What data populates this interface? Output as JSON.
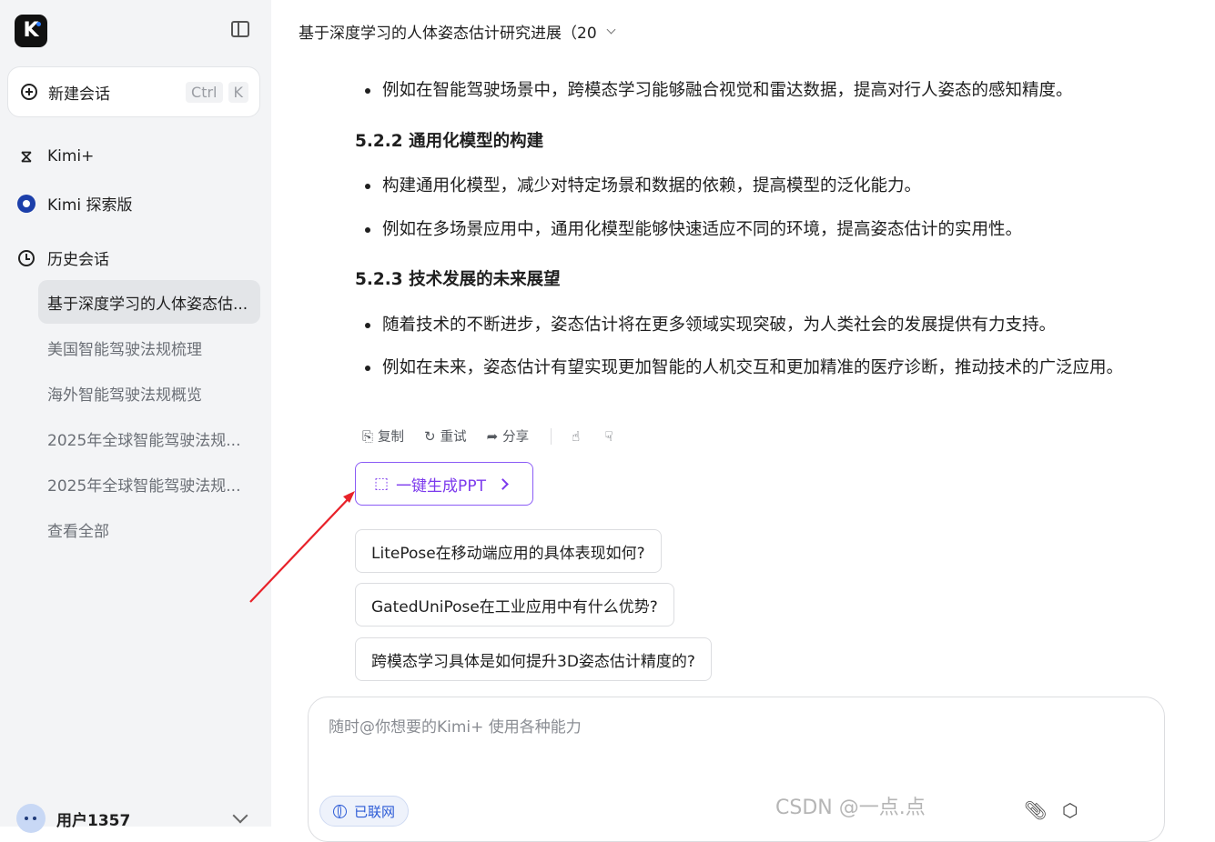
{
  "sidebar": {
    "logo_letter": "K",
    "new_chat": {
      "label": "新建会话",
      "shortcut_keys": [
        "Ctrl",
        "K"
      ]
    },
    "nav": {
      "kimi_plus": "Kimi+",
      "explore": "Kimi 探索版",
      "history": "历史会话"
    },
    "history_items": [
      "基于深度学习的人体姿态估...",
      "美国智能驾驶法规梳理",
      "海外智能驾驶法规概览",
      "2025年全球智能驾驶法规...",
      "2025年全球智能驾驶法规...",
      "查看全部"
    ],
    "user": {
      "name": "用户1357"
    }
  },
  "main": {
    "title": "基于深度学习的人体姿态估计研究进展（20",
    "content": {
      "bullet_1": "例如在智能驾驶场景中，跨模态学习能够融合视觉和雷达数据，提高对行人姿态的感知精度。",
      "heading_2": "5.2.2 通用化模型的构建",
      "bullet_2": "构建通用化模型，减少对特定场景和数据的依赖，提高模型的泛化能力。",
      "bullet_3": "例如在多场景应用中，通用化模型能够快速适应不同的环境，提高姿态估计的实用性。",
      "heading_3": "5.2.3 技术发展的未来展望",
      "bullet_4": "随着技术的不断进步，姿态估计将在更多领域实现突破，为人类社会的发展提供有力支持。",
      "bullet_5": "例如在未来，姿态估计有望实现更加智能的人机交互和更加精准的医疗诊断，推动技术的广泛应用。"
    },
    "actions": {
      "copy": "复制",
      "retry": "重试",
      "share": "分享"
    },
    "ppt_button": "一键生成PPT",
    "suggestions": [
      "LitePose在移动端应用的具体表现如何?",
      "GatedUniPose在工业应用中有什么优势?",
      "跨模态学习具体是如何提升3D姿态估计精度的?"
    ],
    "input": {
      "placeholder": "随时@你想要的Kimi+ 使用各种能力",
      "online_chip": "已联网"
    },
    "watermark": "CSDN @一点.点"
  },
  "colors": {
    "accent_purple": "#7c3aed",
    "arrow_red": "#e8222a",
    "link_blue": "#2c5bd6"
  }
}
